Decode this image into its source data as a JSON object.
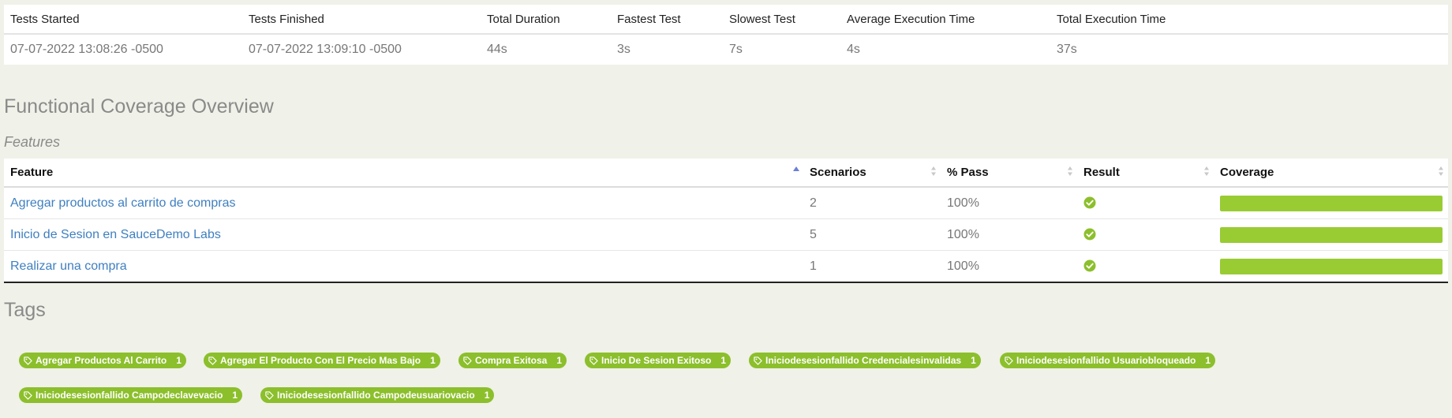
{
  "summary": {
    "headers": [
      "Tests Started",
      "Tests Finished",
      "Total Duration",
      "Fastest Test",
      "Slowest Test",
      "Average Execution Time",
      "Total Execution Time"
    ],
    "values": [
      "07-07-2022 13:08:26 -0500",
      "07-07-2022 13:09:10 -0500",
      "44s",
      "3s",
      "7s",
      "4s",
      "37s"
    ]
  },
  "coverage_title": "Functional Coverage Overview",
  "features_subtitle": "Features",
  "features_table": {
    "headers": {
      "feature": "Feature",
      "scenarios": "Scenarios",
      "pass": "% Pass",
      "result": "Result",
      "coverage": "Coverage"
    },
    "rows": [
      {
        "feature": "Agregar productos al carrito de compras",
        "scenarios": "2",
        "pass": "100%",
        "result": "passed",
        "coverage_fraction": 1.0
      },
      {
        "feature": "Inicio de Sesion en SauceDemo Labs",
        "scenarios": "5",
        "pass": "100%",
        "result": "passed",
        "coverage_fraction": 1.0
      },
      {
        "feature": "Realizar una compra",
        "scenarios": "1",
        "pass": "100%",
        "result": "passed",
        "coverage_fraction": 1.0
      }
    ]
  },
  "tags_title": "Tags",
  "tags": [
    {
      "label": "Agregar Productos Al Carrito",
      "count": "1"
    },
    {
      "label": "Agregar El Producto Con El Precio Mas Bajo",
      "count": "1"
    },
    {
      "label": "Compra Exitosa",
      "count": "1"
    },
    {
      "label": "Inicio De Sesion Exitoso",
      "count": "1"
    },
    {
      "label": "Iniciodesesionfallido Credencialesinvalidas",
      "count": "1"
    },
    {
      "label": "Iniciodesesionfallido Usuariobloqueado",
      "count": "1"
    },
    {
      "label": "Iniciodesesionfallido Campodeclavevacio",
      "count": "1"
    },
    {
      "label": "Iniciodesesionfallido Campodeusuariovacio",
      "count": "1"
    }
  ],
  "colors": {
    "background": "#f0f1e8",
    "link": "#3f7fc0",
    "success": "#8cbf2c",
    "coverage": "#99cc33"
  }
}
